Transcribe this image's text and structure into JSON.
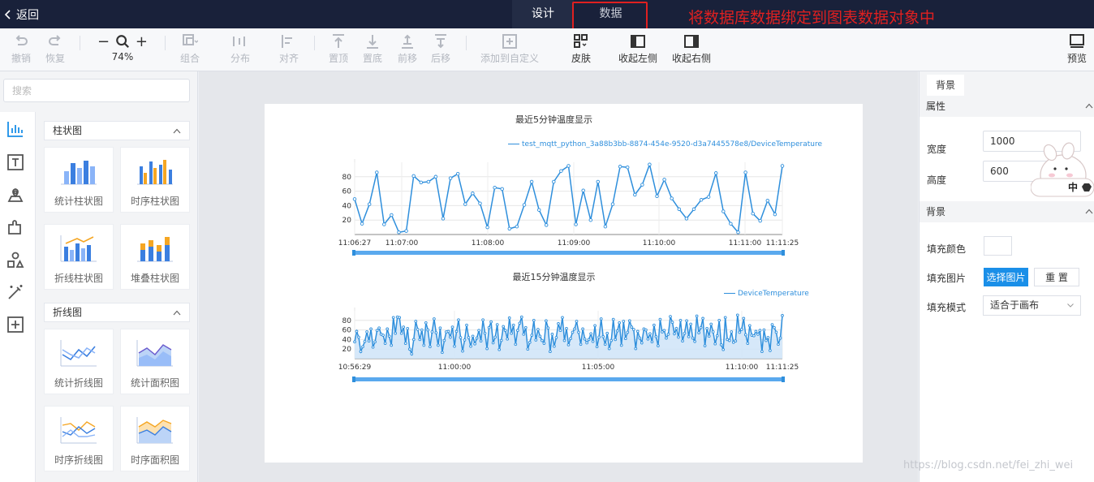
{
  "topbar": {
    "back_label": "返回",
    "tabs": [
      {
        "label": "设计"
      },
      {
        "label": "数据"
      }
    ],
    "annotation": "将数据库数据绑定到图表数据对象中"
  },
  "toolbar": {
    "undo": "撤销",
    "redo": "恢复",
    "zoom_minus": "−",
    "zoom_plus": "+",
    "zoom": "74%",
    "group": "组合",
    "distribute": "分布",
    "align": "对齐",
    "top": "置顶",
    "bottom": "置底",
    "forward": "前移",
    "backward": "后移",
    "add_custom": "添加到自定义",
    "skin": "皮肤",
    "collapse_left": "收起左侧",
    "collapse_right": "收起右侧",
    "preview": "预览"
  },
  "left_panel": {
    "search_placeholder": "搜索",
    "categories": [
      {
        "title": "柱状图",
        "items": [
          {
            "label": "统计柱状图"
          },
          {
            "label": "时序柱状图"
          },
          {
            "label": "折线柱状图"
          },
          {
            "label": "堆叠柱状图"
          }
        ]
      },
      {
        "title": "折线图",
        "items": [
          {
            "label": "统计折线图"
          },
          {
            "label": "统计面积图"
          },
          {
            "label": "时序折线图"
          },
          {
            "label": "时序面积图"
          }
        ]
      }
    ]
  },
  "right_panel": {
    "tab": "背景",
    "section_props": "属性",
    "width_label": "宽度",
    "width_value": "1000",
    "height_label": "高度",
    "height_value": "600",
    "section_bg": "背景",
    "fill_color_label": "填充颜色",
    "fill_image_label": "填充图片",
    "choose_image": "选择图片",
    "reset": "重 置",
    "fill_mode_label": "填充模式",
    "fill_mode_value": "适合于画布",
    "ime_char": "中"
  },
  "watermark": "https://blog.csdn.net/fei_zhi_wei",
  "colors": {
    "accent": "#1a8fe8",
    "line": "#2f8fdc",
    "annotation": "#e02020",
    "topbar": "#19213a"
  },
  "chart_data": [
    {
      "type": "line",
      "title": "最近5分钟温度显示",
      "legend": "test_mqtt_python_3a88b3bb-8874-454e-9520-d3a7445578e8/DeviceTemperature",
      "y_ticks": [
        "20",
        "40",
        "60",
        "80"
      ],
      "x_ticks": [
        "11:06:27",
        "11:07:00",
        "11:08:00",
        "11:09:00",
        "11:10:00",
        "11:11:00",
        "11:11:25"
      ],
      "ylim": [
        0,
        100
      ],
      "series": [
        {
          "values": [
            49,
            15,
            42,
            86,
            14,
            27,
            3,
            5,
            81,
            72,
            73,
            80,
            22,
            78,
            84,
            42,
            57,
            43,
            10,
            65,
            63,
            8,
            11,
            41,
            73,
            34,
            13,
            73,
            88,
            95,
            14,
            61,
            20,
            73,
            11,
            42,
            94,
            93,
            55,
            69,
            97,
            53,
            76,
            50,
            35,
            22,
            35,
            48,
            52,
            85,
            32,
            15,
            3,
            86,
            29,
            19,
            47,
            28,
            95
          ]
        }
      ]
    },
    {
      "type": "area",
      "title": "最近15分钟温度显示",
      "legend": "DeviceTemperature",
      "y_ticks": [
        "20",
        "40",
        "60",
        "80"
      ],
      "x_ticks": [
        "10:56:29",
        "11:00:00",
        "11:05:00",
        "11:10:00",
        "11:11:25"
      ],
      "ylim": [
        0,
        100
      ],
      "series": [
        {
          "values": [
            35,
            57,
            45,
            15,
            25,
            36,
            56,
            37,
            62,
            24,
            35,
            59,
            64,
            51,
            49,
            32,
            62,
            47,
            28,
            86,
            53,
            87,
            86,
            53,
            66,
            32,
            63,
            20,
            10,
            40,
            78,
            61,
            40,
            60,
            28,
            75,
            60,
            25,
            56,
            83,
            54,
            28,
            64,
            13,
            38,
            56,
            57,
            45,
            66,
            26,
            57,
            81,
            44,
            16,
            39,
            70,
            44,
            26,
            47,
            31,
            43,
            59,
            37,
            81,
            53,
            21,
            65,
            77,
            33,
            45,
            71,
            19,
            38,
            67,
            59,
            41,
            85,
            53,
            70,
            30,
            59,
            74,
            87,
            51,
            65,
            20,
            34,
            49,
            80,
            39,
            61,
            47,
            38,
            32,
            79,
            64,
            15,
            51,
            26,
            44,
            73,
            59,
            86,
            38,
            63,
            29,
            42,
            55,
            62,
            78,
            55,
            30,
            62,
            41,
            33,
            40,
            52,
            36,
            69,
            25,
            45,
            83,
            46,
            30,
            53,
            21,
            38,
            82,
            40,
            58,
            75,
            28,
            78,
            42,
            55,
            79,
            66,
            61,
            21,
            57,
            43,
            33,
            62,
            60,
            41,
            52,
            35,
            70,
            46,
            27,
            82,
            56,
            59,
            43,
            51,
            88,
            76,
            52,
            63,
            45,
            80,
            37,
            53,
            79,
            46,
            72,
            43,
            36,
            89,
            54,
            65,
            84,
            27,
            63,
            47,
            72,
            56,
            31,
            48,
            80,
            29,
            19,
            86,
            40,
            38,
            56,
            34,
            37,
            91,
            55,
            61,
            84,
            50,
            32,
            69,
            49,
            48,
            57,
            51,
            59,
            15,
            60,
            38,
            44,
            17,
            71,
            65,
            55,
            30,
            43,
            90
          ]
        }
      ]
    }
  ]
}
